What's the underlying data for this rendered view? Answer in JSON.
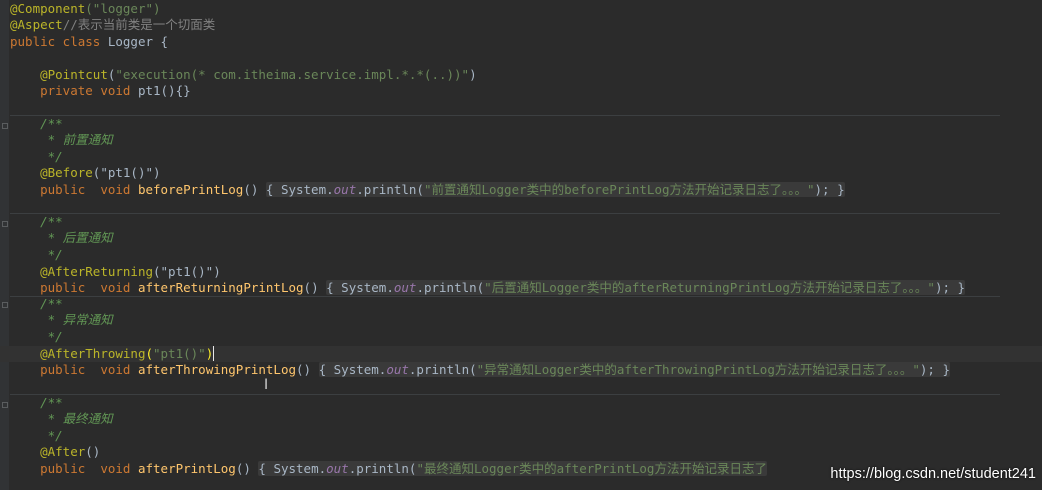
{
  "code": {
    "l01_ann": "@Component",
    "l01_arg": "(\"logger\")",
    "l02_ann": "@Aspect",
    "l02_comment": "//表示当前类是一个切面类",
    "l03_kw": "public class",
    "l03_rest": " Logger {",
    "l04_ann": "@Pointcut",
    "l04_p1": "(",
    "l04_str": "\"execution(* com.itheima.service.impl.*.*(..))\"",
    "l04_p2": ")",
    "l05_kw": "private void",
    "l05_name": " pt1",
    "l05_rest": "(){}",
    "c1_open": "/**",
    "c1_text": " * 前置通知",
    "c_close": " */",
    "l06_ann": "@Before",
    "l06_arg": "(\"pt1()\")",
    "l07_kw1": "public",
    "l07_kw2": "void",
    "l07_name": "beforePrintLog",
    "l07_p": "() ",
    "l07_body1": "{ System.",
    "l07_out": "out",
    "l07_body2": ".println(",
    "l07_str": "\"前置通知Logger类中的beforePrintLog方法开始记录日志了。。。\"",
    "l07_end": "); }",
    "c2_open": "/**",
    "c2_text": " * 后置通知",
    "l08_ann": "@AfterReturning",
    "l08_arg": "(\"pt1()\")",
    "l09_kw1": "public",
    "l09_kw2": "void",
    "l09_name": "afterReturningPrintLog",
    "l09_p": "() ",
    "l09_body1": "{ System.",
    "l09_out": "out",
    "l09_body2": ".println(",
    "l09_str": "\"后置通知Logger类中的afterReturningPrintLog方法开始记录日志了。。。\"",
    "l09_end": "); }",
    "c3_open": "/**",
    "c3_text": " * 异常通知",
    "l10_ann": "@AfterThrowing",
    "l10_p1": "(",
    "l10_str": "\"pt1()\"",
    "l10_p2": ")",
    "l11_kw1": "public",
    "l11_kw2": "void",
    "l11_name": "afterThrowingPrintLog",
    "l11_p": "() ",
    "l11_body1": "{ System.",
    "l11_out": "out",
    "l11_body2": ".println(",
    "l11_str": "\"异常通知Logger类中的afterThrowingPrintLog方法开始记录日志了。。。\"",
    "l11_end": "); }",
    "c4_open": "/**",
    "c4_text": " * 最终通知",
    "l12_ann": "@After",
    "l12_arg": "()",
    "l13_kw1": "public",
    "l13_kw2": "void",
    "l13_name": "afterPrintLog",
    "l13_p": "() ",
    "l13_body1": "{ System.",
    "l13_out": "out",
    "l13_body2": ".println(",
    "l13_str": "\"最终通知Logger类中的afterPrintLog方法开始记录日志了"
  },
  "watermark": "https://blog.csdn.net/student241",
  "colors": {
    "background": "#2b2b2b",
    "keyword": "#cc7832",
    "annotation": "#bbb529",
    "string": "#6a8759",
    "doc_comment": "#629755",
    "method": "#ffc66d",
    "static_field": "#9876aa"
  }
}
